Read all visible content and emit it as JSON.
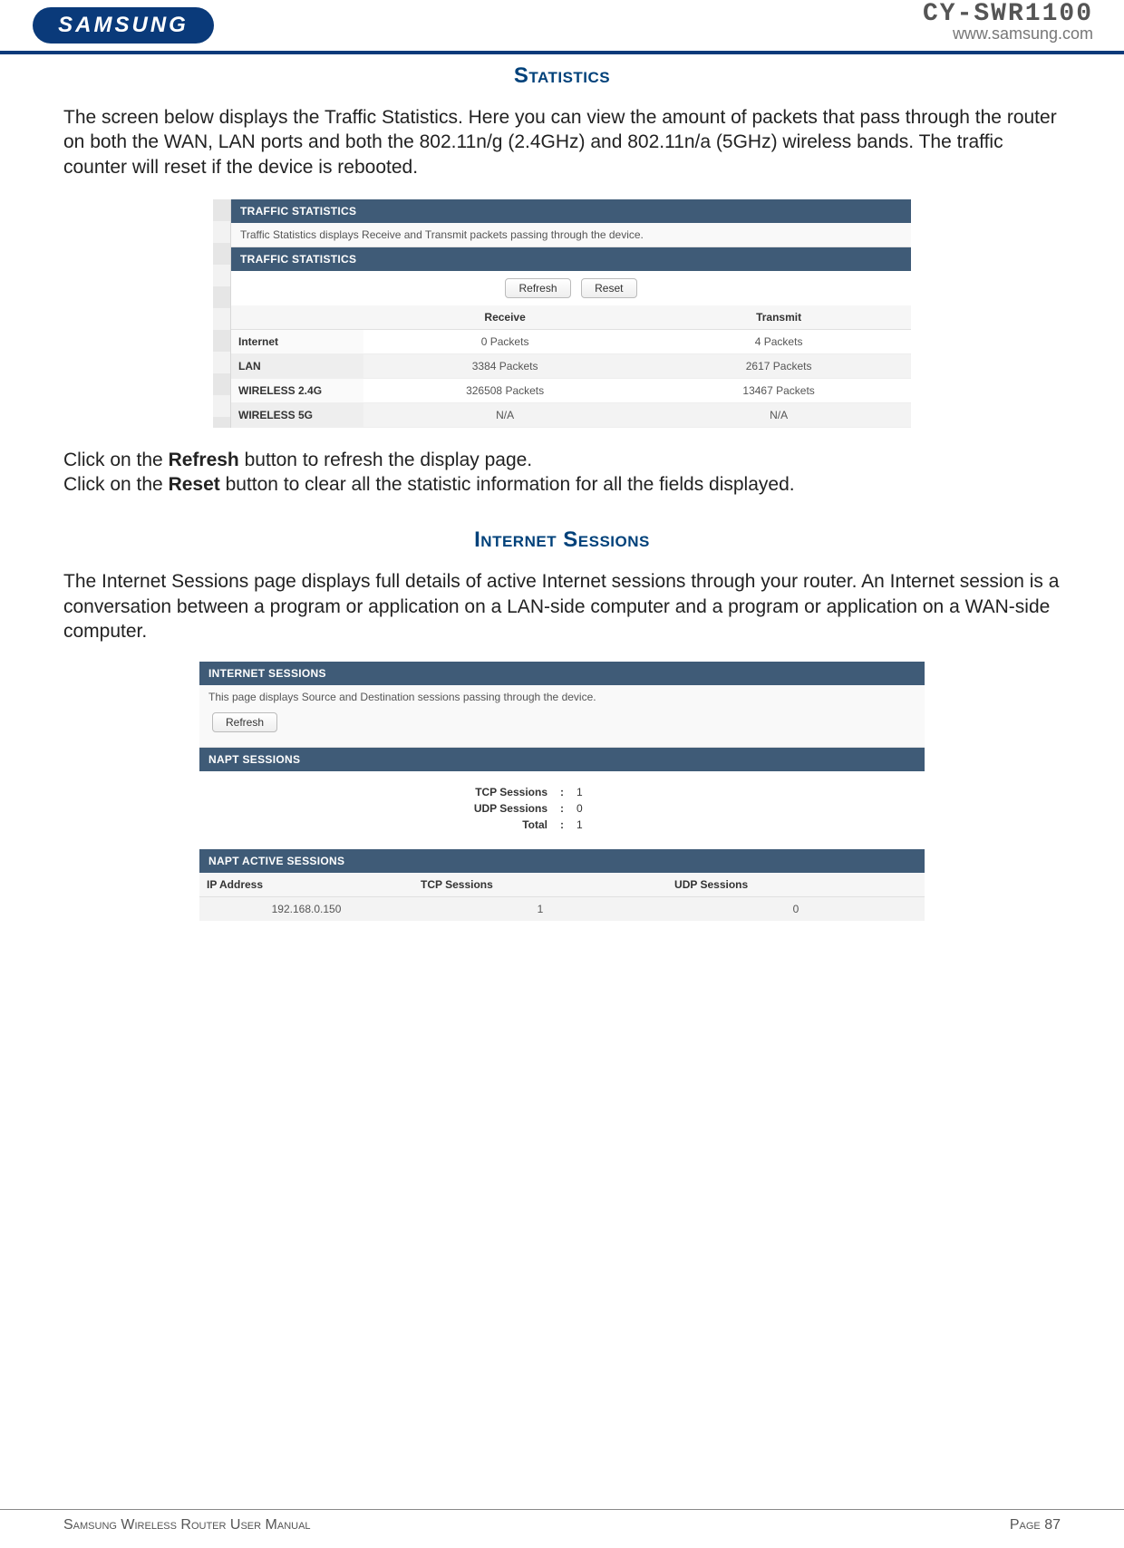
{
  "header": {
    "brand": "SAMSUNG",
    "model": "CY-SWR1100",
    "url": "www.samsung.com"
  },
  "statistics": {
    "title": "Statistics",
    "intro": "The screen below displays the Traffic Statistics. Here you can view the amount of packets that pass through the router on both the WAN, LAN ports and both the 802.11n/g (2.4GHz) and 802.11n/a (5GHz) wireless bands. The traffic counter will reset if the device is rebooted.",
    "panel1_title": "TRAFFIC STATISTICS",
    "panel1_note": "Traffic Statistics displays Receive and Transmit packets passing through the device.",
    "panel2_title": "TRAFFIC STATISTICS",
    "btn_refresh": "Refresh",
    "btn_reset": "Reset",
    "col_receive": "Receive",
    "col_transmit": "Transmit",
    "rows": [
      {
        "label": "Internet",
        "receive": "0 Packets",
        "transmit": "4 Packets"
      },
      {
        "label": "LAN",
        "receive": "3384 Packets",
        "transmit": "2617 Packets"
      },
      {
        "label": "WIRELESS 2.4G",
        "receive": "326508 Packets",
        "transmit": "13467 Packets"
      },
      {
        "label": "WIRELESS 5G",
        "receive": "N/A",
        "transmit": "N/A"
      }
    ],
    "hint_refresh_pre": "Click on the ",
    "hint_refresh_bold": "Refresh",
    "hint_refresh_post": " button to refresh the display page.",
    "hint_reset_pre": "Click on the ",
    "hint_reset_bold": "Reset",
    "hint_reset_post": " button to clear all the statistic information for all the fields displayed."
  },
  "sessions": {
    "title": "Internet Sessions",
    "intro": "The Internet Sessions page displays full details of active Internet sessions through your router. An Internet session is a conversation between a program or application on a LAN-side computer and a program or application on a WAN-side computer.",
    "panel1_title": "INTERNET SESSIONS",
    "panel1_note": "This page displays Source and Destination sessions passing through the device.",
    "btn_refresh": "Refresh",
    "napt_title": "NAPT SESSIONS",
    "summary": {
      "tcp_label": "TCP Sessions",
      "tcp_value": "1",
      "udp_label": "UDP Sessions",
      "udp_value": "0",
      "total_label": "Total",
      "total_value": "1"
    },
    "active_title": "NAPT ACTIVE SESSIONS",
    "active_cols": {
      "ip": "IP Address",
      "tcp": "TCP Sessions",
      "udp": "UDP Sessions"
    },
    "active_rows": [
      {
        "ip": "192.168.0.150",
        "tcp": "1",
        "udp": "0"
      }
    ]
  },
  "footer": {
    "left": "Samsung Wireless Router User Manual",
    "right": "Page 87"
  }
}
